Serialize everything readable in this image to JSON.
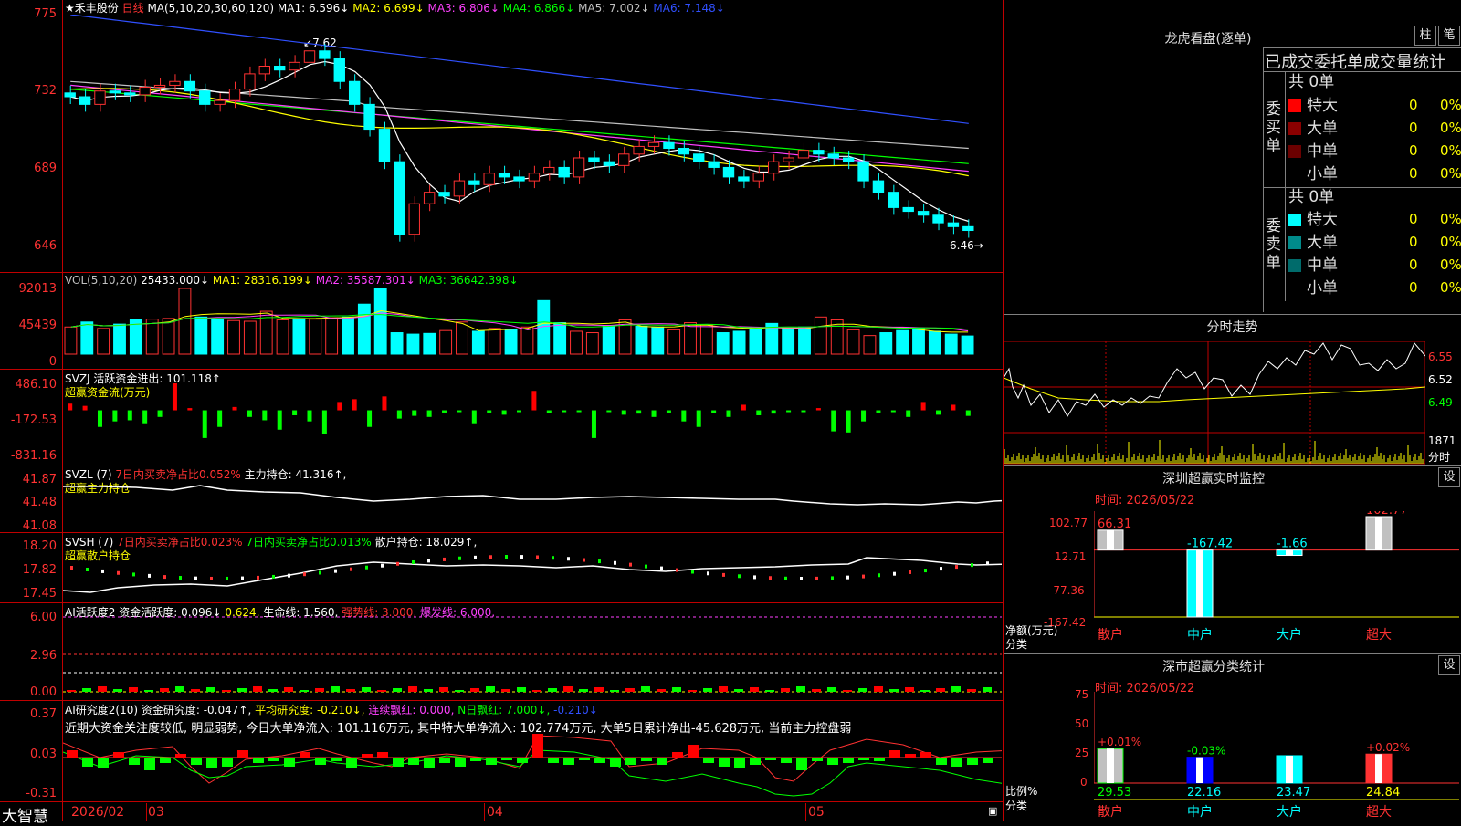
{
  "main_header": {
    "stock": "★禾丰股份",
    "period": "日线",
    "ma_label": "MA(5,10,20,30,60,120)",
    "ma": [
      {
        "label": "MA1: 6.596↓",
        "color": "#ffffff"
      },
      {
        "label": "MA2: 6.699↓",
        "color": "#ffff00"
      },
      {
        "label": "MA3: 6.806↓",
        "color": "#ff40ff"
      },
      {
        "label": "MA4: 6.866↓",
        "color": "#00ff00"
      },
      {
        "label": "MA5: 7.002↓",
        "color": "#c0c0c0"
      },
      {
        "label": "MA6: 7.148↓",
        "color": "#3050ff"
      }
    ],
    "high_mark": "7.62",
    "low_mark": "6.46→"
  },
  "main_axis": [
    "775",
    "732",
    "689",
    "646"
  ],
  "vol_header": {
    "label": "VOL(5,10,20)",
    "value": "25433.000↓",
    "ma1": "MA1: 28316.199↓",
    "ma2": "MA2: 35587.301↓",
    "ma3": "MA3: 36642.398↓"
  },
  "vol_axis": [
    "92013",
    "45439",
    "0"
  ],
  "svzj_header": {
    "label": "SVZJ",
    "name": "活跃资金进出: 101.118↑",
    "sub": "超赢资金流(万元)"
  },
  "svzj_axis": [
    "486.10",
    "-172.53",
    "-831.16"
  ],
  "svzl_header": {
    "label": "SVZL (7)",
    "ratio": "7日内买卖净占比0.052%",
    "hold": "主力持仓: 41.316↑,",
    "sub": "超赢主力持仓"
  },
  "svzl_axis": [
    "41.87",
    "41.48",
    "41.08"
  ],
  "svsh_header": {
    "label": "SVSH (7)",
    "ratio1": "7日内买卖净占比0.023%",
    "ratio2": "7日内买卖净占比0.013%",
    "hold": "散户持仓: 18.029↑,",
    "sub": "超赢散户持仓"
  },
  "svsh_axis": [
    "18.20",
    "17.82",
    "17.45"
  ],
  "ai1_header": {
    "label": "AI活跃度2",
    "a": "资金活跃度: 0.096↓",
    "b": "0.624,",
    "c": "生命线: 1.560,",
    "d": "强势线: 3.000,",
    "e": "爆发线: 6.000,"
  },
  "ai1_axis": [
    "6.00",
    "2.96",
    "0.00"
  ],
  "ai2_header": {
    "label": "AI研究度2(10)",
    "a": "资金研究度: -0.047↑,",
    "b": "平均研究度: -0.210↓,",
    "c": "连续飘红: 0.000,",
    "d": "N日飘红: 7.000↓,",
    "e": "-0.210↓"
  },
  "ai2_axis": [
    "0.37",
    "0.03",
    "-0.31"
  ],
  "ai2_text": "近期大资金关注度较低, 明显弱势, 今日大单净流入: 101.116万元, 其中特大单净流入: 102.774万元, 大单5日累计净出-45.628万元, 当前主力控盘弱",
  "bottom": {
    "brand": "大智慧",
    "dates": [
      "2026/02",
      "03",
      "04",
      "05"
    ]
  },
  "right": {
    "lhb_title": "龙虎看盘(逐单)",
    "btn_zhu": "柱",
    "btn_bi": "笔",
    "tabs_label": "已成交委托单成交量统计",
    "buy": {
      "side": "委买单",
      "total": "共 0单",
      "rows": [
        {
          "name": "特大",
          "color": "#ff0000",
          "n": "0",
          "p": "0%"
        },
        {
          "name": "大单",
          "color": "#8b0000",
          "n": "0",
          "p": "0%"
        },
        {
          "name": "中单",
          "color": "#6b0000",
          "n": "0",
          "p": "0%"
        },
        {
          "name": "小单",
          "color": "#000000",
          "n": "0",
          "p": "0%"
        }
      ]
    },
    "sell": {
      "side": "委卖单",
      "total": "共 0单",
      "rows": [
        {
          "name": "特大",
          "color": "#00ffff",
          "n": "0",
          "p": "0%"
        },
        {
          "name": "大单",
          "color": "#008b8b",
          "n": "0",
          "p": "0%"
        },
        {
          "name": "中单",
          "color": "#006b6b",
          "n": "0",
          "p": "0%"
        },
        {
          "name": "小单",
          "color": "#000000",
          "n": "0",
          "p": "0%"
        }
      ]
    },
    "fs_title": "分时走势",
    "fs_axis": [
      "6.55",
      "6.52",
      "6.49"
    ],
    "fs_vol": "1871",
    "fs_vol_label": "分时",
    "sz_title": "深圳超赢实时监控",
    "sz_time": "时间: 2026/05/22",
    "sz_axis": [
      "102.77",
      "12.71",
      "-77.36",
      "-167.42"
    ],
    "sz_unit": "净额(万元)",
    "sz_unit2": "分类",
    "sz_chart": {
      "type": "bar",
      "categories": [
        "散户",
        "中户",
        "大户",
        "超大"
      ],
      "values": [
        66.31,
        -167.42,
        -1.66,
        102.77
      ],
      "ylim": [
        -167.42,
        102.77
      ]
    },
    "sz_value_labels": [
      "66.31",
      "-167.42",
      "-1.66",
      "102.77"
    ],
    "set_btn": "设",
    "fl_title": "深市超赢分类统计",
    "fl_time": "时间: 2026/05/22",
    "fl_axis": [
      "75",
      "50",
      "25",
      "0"
    ],
    "fl_unit": "比例%",
    "fl_unit2": "分类",
    "fl_chart": {
      "type": "bar",
      "categories": [
        "散户",
        "中户",
        "大户",
        "超大"
      ],
      "values": [
        29.53,
        22.16,
        23.47,
        24.84
      ],
      "changes": [
        "+0.01%",
        "-0.03%",
        "",
        "+0.02%"
      ],
      "ylim": [
        0,
        75
      ]
    },
    "fl_value_labels": [
      "29.53",
      "22.16",
      "23.47",
      "24.84"
    ]
  },
  "chart_data": {
    "type": "bar",
    "title": "★禾丰股份 日线",
    "categories": [],
    "ylim": [
      6.46,
      7.75
    ],
    "series": [
      {
        "name": "K线",
        "values": [
          7.32,
          7.28,
          7.35,
          7.34,
          7.33,
          7.37,
          7.38,
          7.4,
          7.35,
          7.28,
          7.3,
          7.36,
          7.44,
          7.48,
          7.46,
          7.5,
          7.56,
          7.52,
          7.4,
          7.28,
          7.15,
          6.98,
          6.6,
          6.76,
          6.82,
          6.8,
          6.88,
          6.86,
          6.92,
          6.9,
          6.88,
          6.92,
          6.95,
          6.9,
          7.0,
          6.98,
          6.96,
          7.02,
          7.06,
          7.08,
          7.05,
          7.02,
          6.98,
          6.95,
          6.9,
          6.88,
          6.92,
          6.98,
          7.0,
          7.04,
          7.02,
          7.0,
          6.98,
          6.88,
          6.82,
          6.74,
          6.72,
          6.7,
          6.66,
          6.64,
          6.62
        ]
      },
      {
        "name": "VOL",
        "values": [
          38000,
          45000,
          36000,
          42000,
          48000,
          49000,
          50000,
          92013,
          52000,
          48000,
          47000,
          46000,
          60000,
          48000,
          50000,
          49000,
          51000,
          52000,
          70000,
          92000,
          30000,
          28000,
          29000,
          33000,
          45000,
          32000,
          36000,
          34000,
          38000,
          75000,
          44000,
          32000,
          30000,
          40000,
          48000,
          39000,
          38000,
          34000,
          44000,
          41000,
          30000,
          32000,
          34000,
          43000,
          36000,
          38000,
          52000,
          48000,
          34000,
          26000,
          30000,
          33000,
          36000,
          32000,
          28000,
          25433
        ]
      },
      {
        "name": "SVZJ",
        "values": [
          120,
          80,
          -300,
          -200,
          -180,
          -250,
          -120,
          486,
          40,
          -500,
          -300,
          60,
          -120,
          -180,
          -350,
          -90,
          -200,
          -420,
          150,
          200,
          -300,
          250,
          -150,
          -100,
          -120,
          -40,
          -30,
          -250,
          -40,
          -80,
          -20,
          350,
          -50,
          -20,
          -30,
          -500,
          -30,
          -80,
          -60,
          -120,
          -40,
          -200,
          -300,
          -50,
          -120,
          100,
          -90,
          -60,
          -20,
          -20,
          40,
          -380,
          -400,
          -200,
          -40,
          -20,
          -120,
          150,
          -80,
          100,
          -101
        ]
      }
    ]
  }
}
